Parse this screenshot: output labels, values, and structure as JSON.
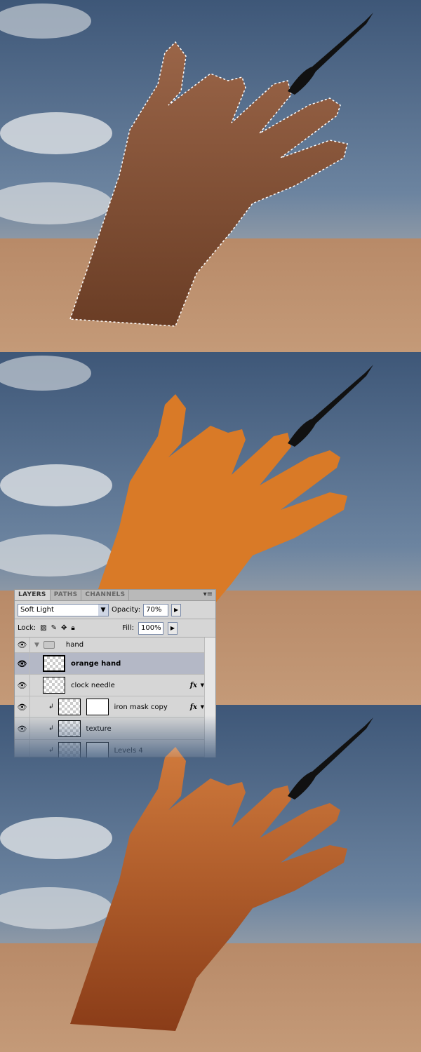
{
  "layers_panel": {
    "tabs": [
      "LAYERS",
      "PATHS",
      "CHANNELS"
    ],
    "active_tab": "LAYERS",
    "blend_mode": "Soft Light",
    "opacity_label": "Opacity:",
    "opacity": "70%",
    "lock_label": "Lock:",
    "fill_label": "Fill:",
    "fill": "100%",
    "layers": [
      {
        "name": "hand",
        "type": "group",
        "visible": true
      },
      {
        "name": "orange hand",
        "selected": true,
        "visible": true
      },
      {
        "name": "clock needle",
        "fx": "fx",
        "visible": true
      },
      {
        "name": "iron mask copy",
        "fx": "fx",
        "clipped": true,
        "mask": true,
        "visible": true
      },
      {
        "name": "texture",
        "clipped": true,
        "visible": true
      },
      {
        "name": "Levels 4",
        "clipped": true
      }
    ]
  },
  "colors": {
    "orange_hand": "#d97a27",
    "sky": "#4f6a8a",
    "sand": "#b98a66",
    "selection_bg": "#b4b8c6"
  }
}
